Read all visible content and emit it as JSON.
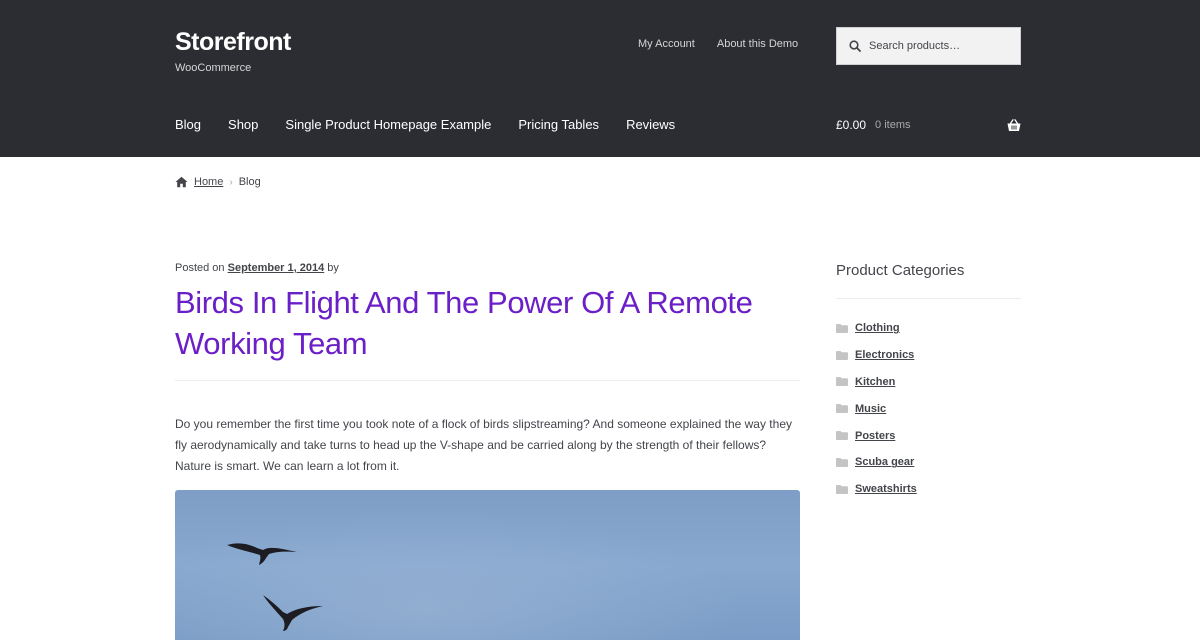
{
  "header": {
    "site_title": "Storefront",
    "tagline": "WooCommerce",
    "secondary_nav": [
      "My Account",
      "About this Demo"
    ],
    "search": {
      "placeholder": "Search products…"
    },
    "primary_nav": [
      "Blog",
      "Shop",
      "Single Product Homepage Example",
      "Pricing Tables",
      "Reviews"
    ],
    "cart": {
      "amount": "£0.00",
      "count": "0 items"
    }
  },
  "breadcrumb": {
    "home": "Home",
    "current": "Blog"
  },
  "post": {
    "meta_prefix": "Posted on",
    "date": "September 1, 2014",
    "meta_suffix": "by",
    "title": "Birds In Flight And The Power Of A Remote Working Team",
    "body": "Do you remember the first time you took note of a flock of birds slipstreaming? And someone explained the way they fly aerodynamically and take turns to head up the V-shape and be carried along by the strength of their fellows? Nature is smart. We can learn a lot from it."
  },
  "sidebar": {
    "widget_title": "Product Categories",
    "categories": [
      "Clothing",
      "Electronics",
      "Kitchen",
      "Music",
      "Posters",
      "Scuba gear",
      "Sweatshirts"
    ]
  },
  "colors": {
    "header_bg": "#2c2d33",
    "title_accent": "#6b1fc7",
    "text": "#43454b"
  }
}
